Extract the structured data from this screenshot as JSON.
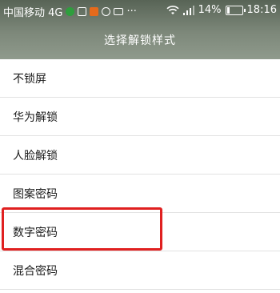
{
  "status_bar": {
    "carrier": "中国移动 4G",
    "more": "···",
    "battery_level": 0.14,
    "battery_text": "14%",
    "time": "18:16",
    "icons": [
      "green-app-icon",
      "image-icon",
      "orange-app-icon",
      "alarm-icon",
      "mail-icon",
      "wifi-icon",
      "signal-icon",
      "battery-icon"
    ]
  },
  "header": {
    "title": "选择解锁样式"
  },
  "list": {
    "items": [
      {
        "label": "不锁屏"
      },
      {
        "label": "华为解锁"
      },
      {
        "label": "人脸解锁"
      },
      {
        "label": "图案密码"
      },
      {
        "label": "数字密码"
      },
      {
        "label": "混合密码"
      }
    ]
  },
  "colors": {
    "header_top": "#586456",
    "header_bottom": "#8f9a8c",
    "highlight": "#e02020",
    "divider": "#e2e2e2"
  }
}
